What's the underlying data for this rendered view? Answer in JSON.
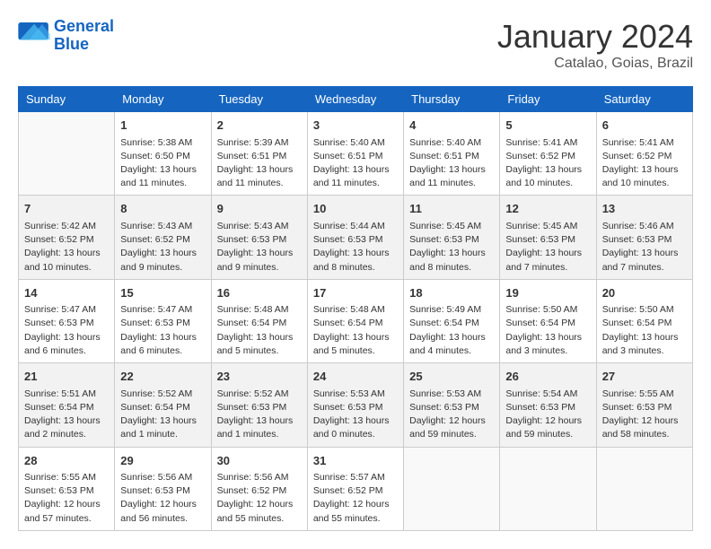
{
  "logo": {
    "line1": "General",
    "line2": "Blue"
  },
  "title": "January 2024",
  "subtitle": "Catalao, Goias, Brazil",
  "weekdays": [
    "Sunday",
    "Monday",
    "Tuesday",
    "Wednesday",
    "Thursday",
    "Friday",
    "Saturday"
  ],
  "weeks": [
    [
      {
        "day": "",
        "sunrise": "",
        "sunset": "",
        "daylight": ""
      },
      {
        "day": "1",
        "sunrise": "Sunrise: 5:38 AM",
        "sunset": "Sunset: 6:50 PM",
        "daylight": "Daylight: 13 hours and 11 minutes."
      },
      {
        "day": "2",
        "sunrise": "Sunrise: 5:39 AM",
        "sunset": "Sunset: 6:51 PM",
        "daylight": "Daylight: 13 hours and 11 minutes."
      },
      {
        "day": "3",
        "sunrise": "Sunrise: 5:40 AM",
        "sunset": "Sunset: 6:51 PM",
        "daylight": "Daylight: 13 hours and 11 minutes."
      },
      {
        "day": "4",
        "sunrise": "Sunrise: 5:40 AM",
        "sunset": "Sunset: 6:51 PM",
        "daylight": "Daylight: 13 hours and 11 minutes."
      },
      {
        "day": "5",
        "sunrise": "Sunrise: 5:41 AM",
        "sunset": "Sunset: 6:52 PM",
        "daylight": "Daylight: 13 hours and 10 minutes."
      },
      {
        "day": "6",
        "sunrise": "Sunrise: 5:41 AM",
        "sunset": "Sunset: 6:52 PM",
        "daylight": "Daylight: 13 hours and 10 minutes."
      }
    ],
    [
      {
        "day": "7",
        "sunrise": "Sunrise: 5:42 AM",
        "sunset": "Sunset: 6:52 PM",
        "daylight": "Daylight: 13 hours and 10 minutes."
      },
      {
        "day": "8",
        "sunrise": "Sunrise: 5:43 AM",
        "sunset": "Sunset: 6:52 PM",
        "daylight": "Daylight: 13 hours and 9 minutes."
      },
      {
        "day": "9",
        "sunrise": "Sunrise: 5:43 AM",
        "sunset": "Sunset: 6:53 PM",
        "daylight": "Daylight: 13 hours and 9 minutes."
      },
      {
        "day": "10",
        "sunrise": "Sunrise: 5:44 AM",
        "sunset": "Sunset: 6:53 PM",
        "daylight": "Daylight: 13 hours and 8 minutes."
      },
      {
        "day": "11",
        "sunrise": "Sunrise: 5:45 AM",
        "sunset": "Sunset: 6:53 PM",
        "daylight": "Daylight: 13 hours and 8 minutes."
      },
      {
        "day": "12",
        "sunrise": "Sunrise: 5:45 AM",
        "sunset": "Sunset: 6:53 PM",
        "daylight": "Daylight: 13 hours and 7 minutes."
      },
      {
        "day": "13",
        "sunrise": "Sunrise: 5:46 AM",
        "sunset": "Sunset: 6:53 PM",
        "daylight": "Daylight: 13 hours and 7 minutes."
      }
    ],
    [
      {
        "day": "14",
        "sunrise": "Sunrise: 5:47 AM",
        "sunset": "Sunset: 6:53 PM",
        "daylight": "Daylight: 13 hours and 6 minutes."
      },
      {
        "day": "15",
        "sunrise": "Sunrise: 5:47 AM",
        "sunset": "Sunset: 6:53 PM",
        "daylight": "Daylight: 13 hours and 6 minutes."
      },
      {
        "day": "16",
        "sunrise": "Sunrise: 5:48 AM",
        "sunset": "Sunset: 6:54 PM",
        "daylight": "Daylight: 13 hours and 5 minutes."
      },
      {
        "day": "17",
        "sunrise": "Sunrise: 5:48 AM",
        "sunset": "Sunset: 6:54 PM",
        "daylight": "Daylight: 13 hours and 5 minutes."
      },
      {
        "day": "18",
        "sunrise": "Sunrise: 5:49 AM",
        "sunset": "Sunset: 6:54 PM",
        "daylight": "Daylight: 13 hours and 4 minutes."
      },
      {
        "day": "19",
        "sunrise": "Sunrise: 5:50 AM",
        "sunset": "Sunset: 6:54 PM",
        "daylight": "Daylight: 13 hours and 3 minutes."
      },
      {
        "day": "20",
        "sunrise": "Sunrise: 5:50 AM",
        "sunset": "Sunset: 6:54 PM",
        "daylight": "Daylight: 13 hours and 3 minutes."
      }
    ],
    [
      {
        "day": "21",
        "sunrise": "Sunrise: 5:51 AM",
        "sunset": "Sunset: 6:54 PM",
        "daylight": "Daylight: 13 hours and 2 minutes."
      },
      {
        "day": "22",
        "sunrise": "Sunrise: 5:52 AM",
        "sunset": "Sunset: 6:54 PM",
        "daylight": "Daylight: 13 hours and 1 minute."
      },
      {
        "day": "23",
        "sunrise": "Sunrise: 5:52 AM",
        "sunset": "Sunset: 6:53 PM",
        "daylight": "Daylight: 13 hours and 1 minutes."
      },
      {
        "day": "24",
        "sunrise": "Sunrise: 5:53 AM",
        "sunset": "Sunset: 6:53 PM",
        "daylight": "Daylight: 13 hours and 0 minutes."
      },
      {
        "day": "25",
        "sunrise": "Sunrise: 5:53 AM",
        "sunset": "Sunset: 6:53 PM",
        "daylight": "Daylight: 12 hours and 59 minutes."
      },
      {
        "day": "26",
        "sunrise": "Sunrise: 5:54 AM",
        "sunset": "Sunset: 6:53 PM",
        "daylight": "Daylight: 12 hours and 59 minutes."
      },
      {
        "day": "27",
        "sunrise": "Sunrise: 5:55 AM",
        "sunset": "Sunset: 6:53 PM",
        "daylight": "Daylight: 12 hours and 58 minutes."
      }
    ],
    [
      {
        "day": "28",
        "sunrise": "Sunrise: 5:55 AM",
        "sunset": "Sunset: 6:53 PM",
        "daylight": "Daylight: 12 hours and 57 minutes."
      },
      {
        "day": "29",
        "sunrise": "Sunrise: 5:56 AM",
        "sunset": "Sunset: 6:53 PM",
        "daylight": "Daylight: 12 hours and 56 minutes."
      },
      {
        "day": "30",
        "sunrise": "Sunrise: 5:56 AM",
        "sunset": "Sunset: 6:52 PM",
        "daylight": "Daylight: 12 hours and 55 minutes."
      },
      {
        "day": "31",
        "sunrise": "Sunrise: 5:57 AM",
        "sunset": "Sunset: 6:52 PM",
        "daylight": "Daylight: 12 hours and 55 minutes."
      },
      {
        "day": "",
        "sunrise": "",
        "sunset": "",
        "daylight": ""
      },
      {
        "day": "",
        "sunrise": "",
        "sunset": "",
        "daylight": ""
      },
      {
        "day": "",
        "sunrise": "",
        "sunset": "",
        "daylight": ""
      }
    ]
  ]
}
